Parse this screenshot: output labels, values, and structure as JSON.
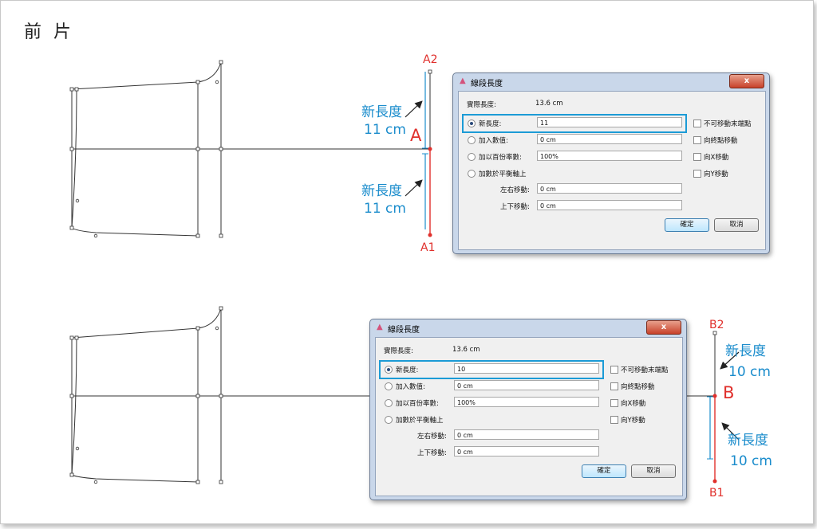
{
  "page": {
    "title": "前 片"
  },
  "top": {
    "point_top": "A2",
    "point_mid": "A",
    "point_bottom": "A1",
    "annot_upper": {
      "label": "新長度",
      "value": "11 cm"
    },
    "annot_lower": {
      "label": "新長度",
      "value": "11 cm"
    }
  },
  "bottom": {
    "point_top": "B2",
    "point_mid": "B",
    "point_bottom": "B1",
    "annot_upper": {
      "label": "新長度",
      "value": "10 cm"
    },
    "annot_lower": {
      "label": "新長度",
      "value": "10 cm"
    }
  },
  "dialog1": {
    "title": "線段長度",
    "close": "x",
    "actual_label": "實際長度:",
    "actual_value": "13.6 cm",
    "new_len_label": "新長度:",
    "new_len_value": "11",
    "add_label": "加入數值:",
    "add_value": "0 cm",
    "pct_label": "加以百份率數:",
    "pct_value": "100%",
    "axis_label": "加數於平衡軸上",
    "lr_label": "左右移動:",
    "lr_value": "0 cm",
    "ud_label": "上下移動:",
    "ud_value": "0 cm",
    "chk1": "不可移動末端點",
    "chk2": "向終點移動",
    "chk3": "向X移動",
    "chk4": "向Y移動",
    "ok": "確定",
    "cancel": "取消"
  },
  "dialog2": {
    "title": "線段長度",
    "close": "x",
    "actual_label": "實際長度:",
    "actual_value": "13.6 cm",
    "new_len_label": "新長度:",
    "new_len_value": "10",
    "add_label": "加入數值:",
    "add_value": "0 cm",
    "pct_label": "加以百份率數:",
    "pct_value": "100%",
    "axis_label": "加數於平衡軸上",
    "lr_label": "左右移動:",
    "lr_value": "0 cm",
    "ud_label": "上下移動:",
    "ud_value": "0 cm",
    "chk1": "不可移動末端點",
    "chk2": "向終點移動",
    "chk3": "向X移動",
    "chk4": "向Y移動",
    "ok": "確定",
    "cancel": "取消"
  },
  "colors": {
    "accent_blue": "#1a8ccc",
    "accent_red": "#e0302c",
    "highlight": "#1c9bd6"
  }
}
